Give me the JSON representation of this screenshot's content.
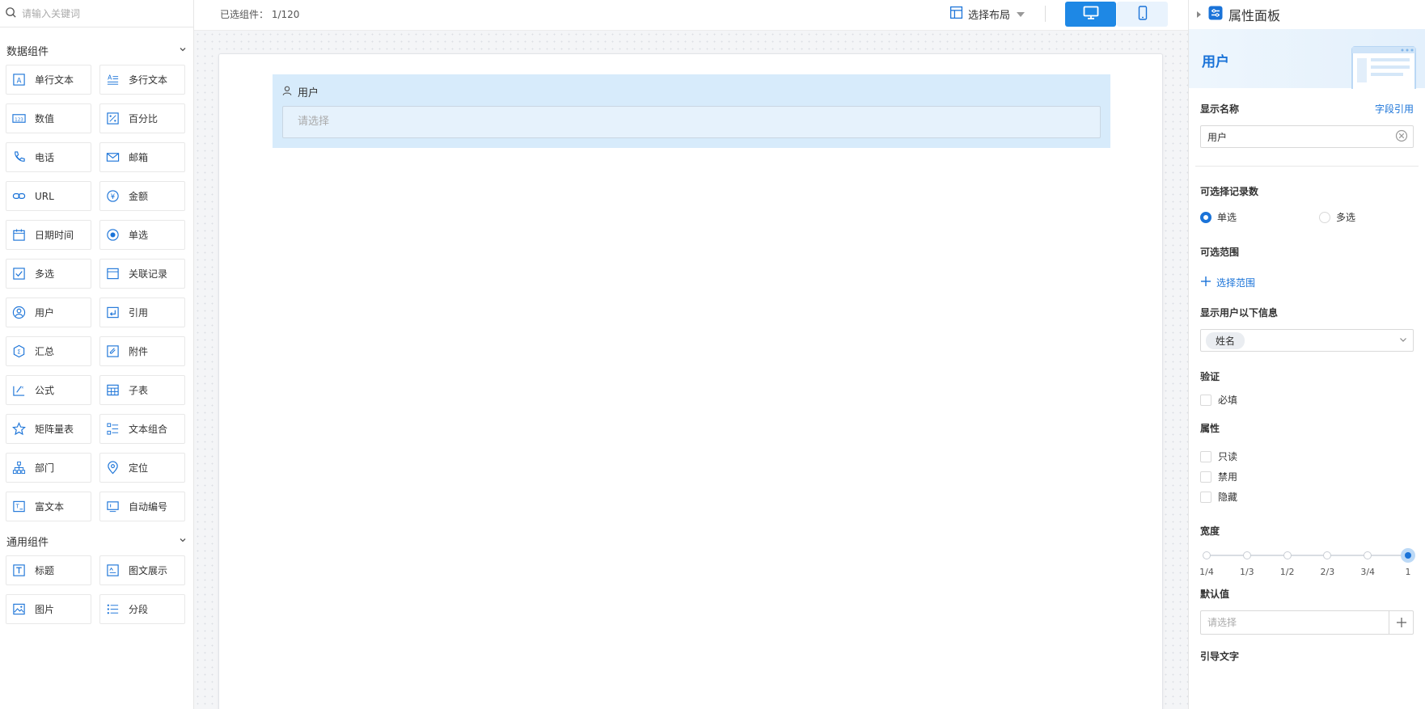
{
  "search": {
    "placeholder": "请输入关键词"
  },
  "groups": {
    "data": {
      "title": "数据组件",
      "items": [
        "单行文本",
        "多行文本",
        "数值",
        "百分比",
        "电话",
        "邮箱",
        "URL",
        "金额",
        "日期时间",
        "单选",
        "多选",
        "关联记录",
        "用户",
        "引用",
        "汇总",
        "附件",
        "公式",
        "子表",
        "矩阵量表",
        "文本组合",
        "部门",
        "定位",
        "富文本",
        "自动编号"
      ]
    },
    "general": {
      "title": "通用组件",
      "items": [
        "标题",
        "图文展示",
        "图片",
        "分段"
      ]
    }
  },
  "topbar": {
    "selected_label": "已选组件：",
    "selected_value": "1/120",
    "layout_label": "选择布局"
  },
  "canvas": {
    "field_label": "用户",
    "field_placeholder": "请选择"
  },
  "panel": {
    "title": "属性面板",
    "banner_title": "用户",
    "display_name_label": "显示名称",
    "field_ref_link": "字段引用",
    "display_name_value": "用户",
    "records_label": "可选择记录数",
    "radio_single": "单选",
    "radio_multi": "多选",
    "selected_mode": "单选",
    "range_label": "可选范围",
    "range_button": "选择范围",
    "show_info_label": "显示用户以下信息",
    "show_info_tag": "姓名",
    "validation_label": "验证",
    "required_label": "必填",
    "props_label": "属性",
    "prop_readonly": "只读",
    "prop_disabled": "禁用",
    "prop_hidden": "隐藏",
    "width_label": "宽度",
    "width_options": [
      "1/4",
      "1/3",
      "1/2",
      "2/3",
      "3/4",
      "1"
    ],
    "width_selected": "1",
    "default_label": "默认值",
    "default_placeholder": "请选择",
    "guide_label": "引导文字"
  },
  "colors": {
    "accent": "#1a73d8",
    "selected_field_bg": "#d7ebfb",
    "device_active": "#1e88e5"
  },
  "icons": {
    "data": [
      "text-field-icon",
      "multiline-text-icon",
      "number-icon",
      "percent-icon",
      "phone-icon",
      "mail-icon",
      "link-icon",
      "money-icon",
      "calendar-icon",
      "radio-icon",
      "checkbox-icon",
      "related-record-icon",
      "user-icon",
      "quote-icon",
      "summary-icon",
      "attachment-icon",
      "formula-icon",
      "subtable-icon",
      "matrix-scale-icon",
      "text-group-icon",
      "department-icon",
      "location-icon",
      "rich-text-icon",
      "auto-number-icon"
    ],
    "general": [
      "heading-icon",
      "image-text-icon",
      "image-icon",
      "section-icon"
    ]
  }
}
